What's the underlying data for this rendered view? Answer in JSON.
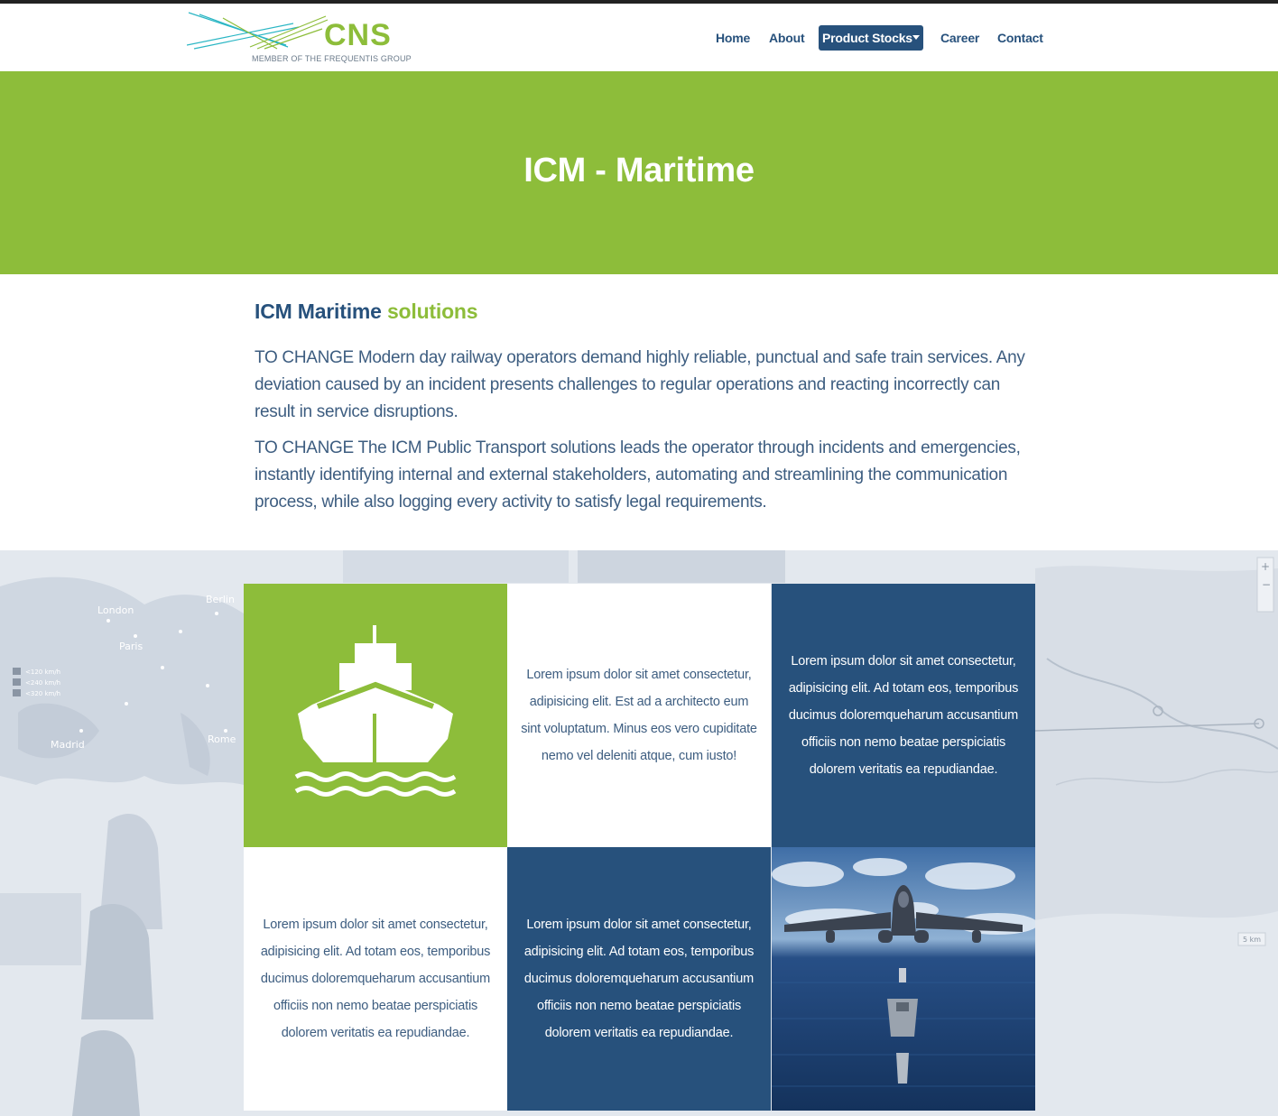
{
  "brand": {
    "name": "CNS",
    "tagline": "MEMBER OF THE FREQUENTIS GROUP"
  },
  "nav": {
    "home": "Home",
    "about": "About",
    "product_stocks": "Product Stocks",
    "career": "Career",
    "contact": "Contact"
  },
  "hero": {
    "title": "ICM - Maritime"
  },
  "intro": {
    "heading_main": "ICM Maritime",
    "heading_accent": "solutions",
    "paragraph_1": "TO CHANGE Modern day railway operators demand highly reliable, punctual and safe train services. Any deviation caused by an incident presents challenges to regular operations and reacting incorrectly can result in service disruptions.",
    "paragraph_2": "TO CHANGE The ICM Public Transport solutions leads the operator through incidents and emergencies, instantly identifying internal and external stakeholders, automating and streamlining the communication process, while also logging every activity to satisfy legal requirements."
  },
  "background_map": {
    "labels": [
      "London",
      "Berlin",
      "Paris",
      "Madrid",
      "Rome",
      "<120 km/h",
      "<240 km/h",
      "<320 km/h",
      "5 km"
    ]
  },
  "grid": {
    "icon": "ship-icon",
    "cell_1_text": "Lorem ipsum dolor sit amet consectetur, adipisicing elit. Est ad a architecto eum sint voluptatum. Minus eos vero cupiditate nemo vel deleniti atque, cum iusto!",
    "cell_2_text": "Lorem ipsum dolor sit amet consectetur, adipisicing elit. Ad totam eos, temporibus ducimus doloremqueharum accusantium officiis non nemo beatae perspiciatis dolorem veritatis ea repudiandae.",
    "cell_3_text": "Lorem ipsum dolor sit amet consectetur, adipisicing elit. Ad totam eos, temporibus ducimus doloremqueharum accusantium officiis non nemo beatae perspiciatis dolorem veritatis ea repudiandae.",
    "cell_4_text": "Lorem ipsum dolor sit amet consectetur, adipisicing elit. Ad totam eos, temporibus ducimus doloremqueharum accusantium officiis non nemo beatae perspiciatis dolorem veritatis ea repudiandae.",
    "photo": "fighter-jet-and-fleet-photo"
  },
  "colors": {
    "green": "#8dbd3a",
    "navy": "#27517c",
    "text": "#3d5d80",
    "band": "#e3e8ee"
  }
}
